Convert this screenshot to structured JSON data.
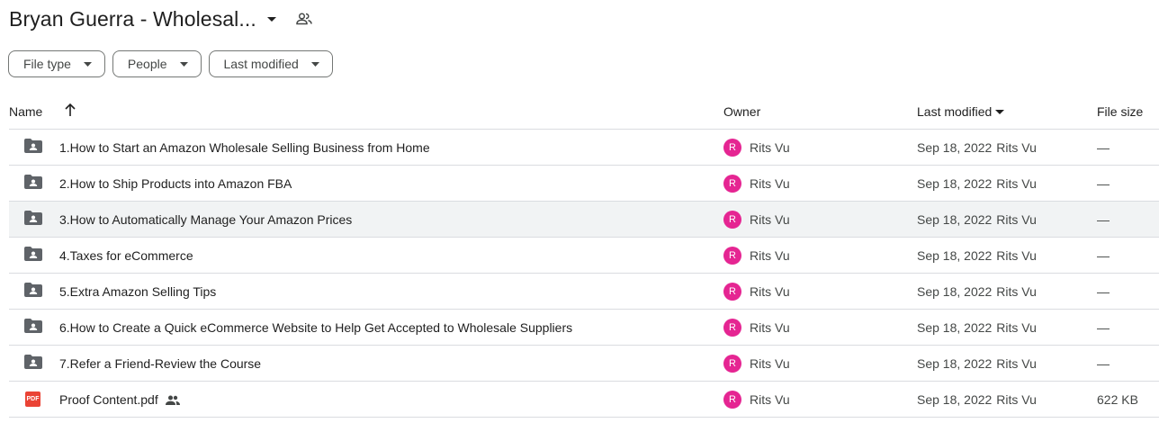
{
  "header": {
    "folder_title": "Bryan Guerra - Wholesal...",
    "title_caret_icon": "caret-down-icon",
    "shared_icon": "people-outline-icon"
  },
  "filters": [
    {
      "label": "File type"
    },
    {
      "label": "People"
    },
    {
      "label": "Last modified"
    }
  ],
  "columns": {
    "name": "Name",
    "owner": "Owner",
    "last_modified": "Last modified",
    "file_size": "File size",
    "name_sort_icon": "arrow-up-icon",
    "modified_sort_icon": "caret-down-icon"
  },
  "rows": [
    {
      "type": "shared-folder",
      "name": "1.How to Start an Amazon Wholesale Selling Business from Home",
      "owner_initial": "R",
      "owner": "Rits Vu",
      "modified_date": "Sep 18, 2022",
      "modified_by": "Rits Vu",
      "size": "—"
    },
    {
      "type": "shared-folder",
      "name": "2.How to Ship Products into Amazon FBA",
      "owner_initial": "R",
      "owner": "Rits Vu",
      "modified_date": "Sep 18, 2022",
      "modified_by": "Rits Vu",
      "size": "—"
    },
    {
      "type": "shared-folder",
      "name": "3.How to Automatically Manage Your Amazon Prices",
      "owner_initial": "R",
      "owner": "Rits Vu",
      "modified_date": "Sep 18, 2022",
      "modified_by": "Rits Vu",
      "size": "—"
    },
    {
      "type": "shared-folder",
      "name": "4.Taxes for eCommerce",
      "owner_initial": "R",
      "owner": "Rits Vu",
      "modified_date": "Sep 18, 2022",
      "modified_by": "Rits Vu",
      "size": "—"
    },
    {
      "type": "shared-folder",
      "name": "5.Extra Amazon Selling Tips",
      "owner_initial": "R",
      "owner": "Rits Vu",
      "modified_date": "Sep 18, 2022",
      "modified_by": "Rits Vu",
      "size": "—"
    },
    {
      "type": "shared-folder",
      "name": "6.How to Create a Quick eCommerce Website to Help Get Accepted to Wholesale Suppliers",
      "owner_initial": "R",
      "owner": "Rits Vu",
      "modified_date": "Sep 18, 2022",
      "modified_by": "Rits Vu",
      "size": "—"
    },
    {
      "type": "shared-folder",
      "name": "7.Refer a Friend-Review the Course",
      "owner_initial": "R",
      "owner": "Rits Vu",
      "modified_date": "Sep 18, 2022",
      "modified_by": "Rits Vu",
      "size": "—"
    },
    {
      "type": "pdf",
      "name": "Proof Content.pdf",
      "pdf_badge": "PDF",
      "owner_initial": "R",
      "owner": "Rits Vu",
      "modified_date": "Sep 18, 2022",
      "modified_by": "Rits Vu",
      "size": "622 KB"
    }
  ],
  "colors": {
    "avatar": "#e52592",
    "pdf": "#ea4335",
    "folder_icon": "#5f6368",
    "row_highlight": "#f1f3f4"
  }
}
